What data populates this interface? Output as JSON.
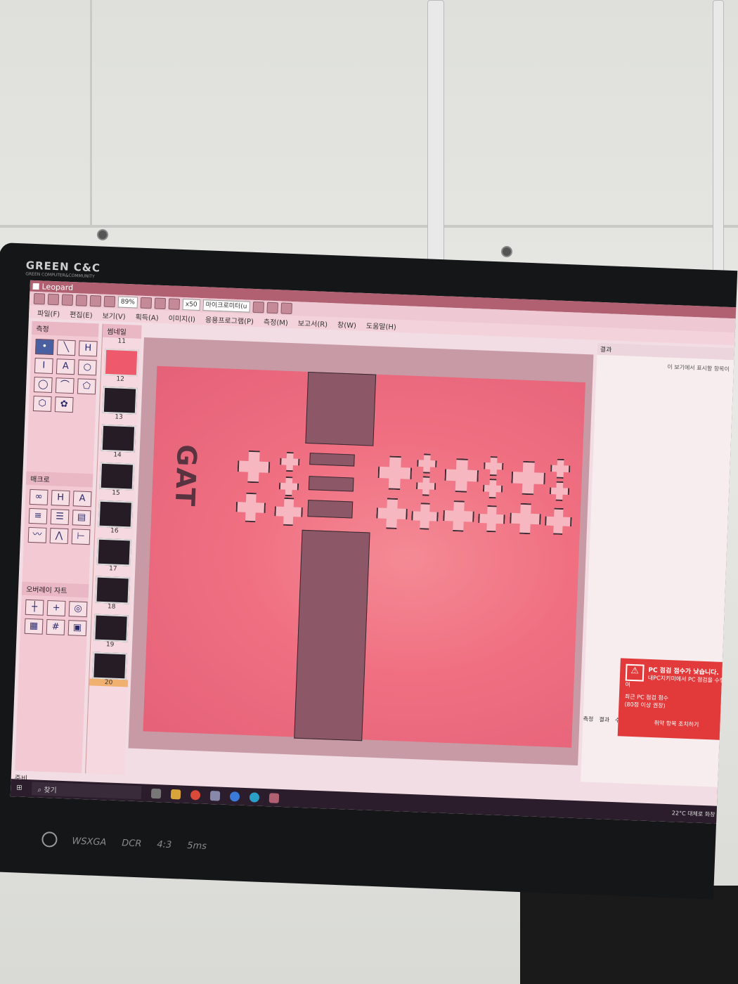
{
  "monitor": {
    "brand": "GREEN C&C",
    "brand_sub": "GREEN COMPUTER&COMMUNITY",
    "specs": [
      "WSXGA",
      "DCR",
      "4:3",
      "5ms"
    ]
  },
  "app": {
    "title": "Leopard",
    "toolbar": {
      "zoom": "89%",
      "objective": "x50",
      "unit": "마이크로미터(u"
    },
    "menu": [
      "파일(F)",
      "편집(E)",
      "보기(V)",
      "획득(A)",
      "이미지(I)",
      "응용프로그램(P)",
      "측정(M)",
      "보고서(R)",
      "창(W)",
      "도움말(H)"
    ],
    "panels": {
      "measure": "측정",
      "macro": "매크로",
      "overlay": "오버레이 자트",
      "thumbnail": "썸네일",
      "result": "결과"
    },
    "thumbnails": [
      "11",
      "12",
      "13",
      "14",
      "15",
      "16",
      "17",
      "18",
      "19",
      "20"
    ],
    "result_msg": "이 보기에서 표시할 항목이",
    "status": "준비",
    "tabs": [
      "측정",
      "결과",
      "수집"
    ]
  },
  "image": {
    "label": "GAT"
  },
  "alert": {
    "title": "PC 점검 점수가 낮습니다.",
    "line1": "내PC지키미에서 PC 점검을 수행하여",
    "line2": "최근 PC 점검 점수",
    "line3": "(80점 이상 권장)",
    "action": "취약 항목 조치하기"
  },
  "taskbar": {
    "search_placeholder": "찾기",
    "weather": "22°C 대체로 화창"
  },
  "colors": {
    "accent": "#b06070",
    "alert": "#e23a3a",
    "sample": "#f07082"
  }
}
